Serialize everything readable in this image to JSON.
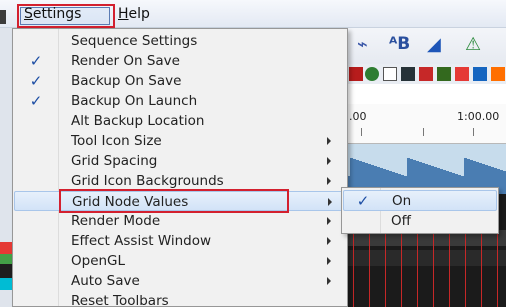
{
  "menubar": {
    "items": [
      {
        "label": "Settings",
        "mnemonic": "S"
      },
      {
        "label": "Help",
        "mnemonic": "H"
      }
    ]
  },
  "toolbar": {
    "icons": [
      "flow-icon",
      "text-effect-icon",
      "brush-icon",
      "tree-icon"
    ],
    "text_glyph": "ᴬB"
  },
  "timeline": {
    "tick_labels": [
      ".00",
      "1:00.00"
    ]
  },
  "settings_menu": {
    "items": [
      {
        "label": "Sequence Settings",
        "checked": false,
        "submenu": false
      },
      {
        "label": "Render On Save",
        "checked": true,
        "submenu": false
      },
      {
        "label": "Backup On Save",
        "checked": true,
        "submenu": false
      },
      {
        "label": "Backup On Launch",
        "checked": true,
        "submenu": false
      },
      {
        "label": "Alt Backup Location",
        "checked": false,
        "submenu": false
      },
      {
        "label": "Tool Icon Size",
        "checked": false,
        "submenu": true
      },
      {
        "label": "Grid Spacing",
        "checked": false,
        "submenu": true
      },
      {
        "label": "Grid Icon Backgrounds",
        "checked": false,
        "submenu": true
      },
      {
        "label": "Grid Node Values",
        "checked": false,
        "submenu": true,
        "active": true
      },
      {
        "label": "Render Mode",
        "checked": false,
        "submenu": true
      },
      {
        "label": "Effect Assist Window",
        "checked": false,
        "submenu": true
      },
      {
        "label": "OpenGL",
        "checked": false,
        "submenu": true
      },
      {
        "label": "Auto Save",
        "checked": false,
        "submenu": true
      },
      {
        "label": "Reset Toolbars",
        "checked": false,
        "submenu": false
      }
    ],
    "check_glyph": "✓"
  },
  "grid_node_values_submenu": {
    "items": [
      {
        "label": "On",
        "checked": true
      },
      {
        "label": "Off",
        "checked": false
      }
    ]
  },
  "colors": {
    "highlight_border": "#d3202f",
    "check_color": "#1d4ea4",
    "menu_bg": "#f1f1f1",
    "active_item_bg": "#d2e3f7"
  }
}
